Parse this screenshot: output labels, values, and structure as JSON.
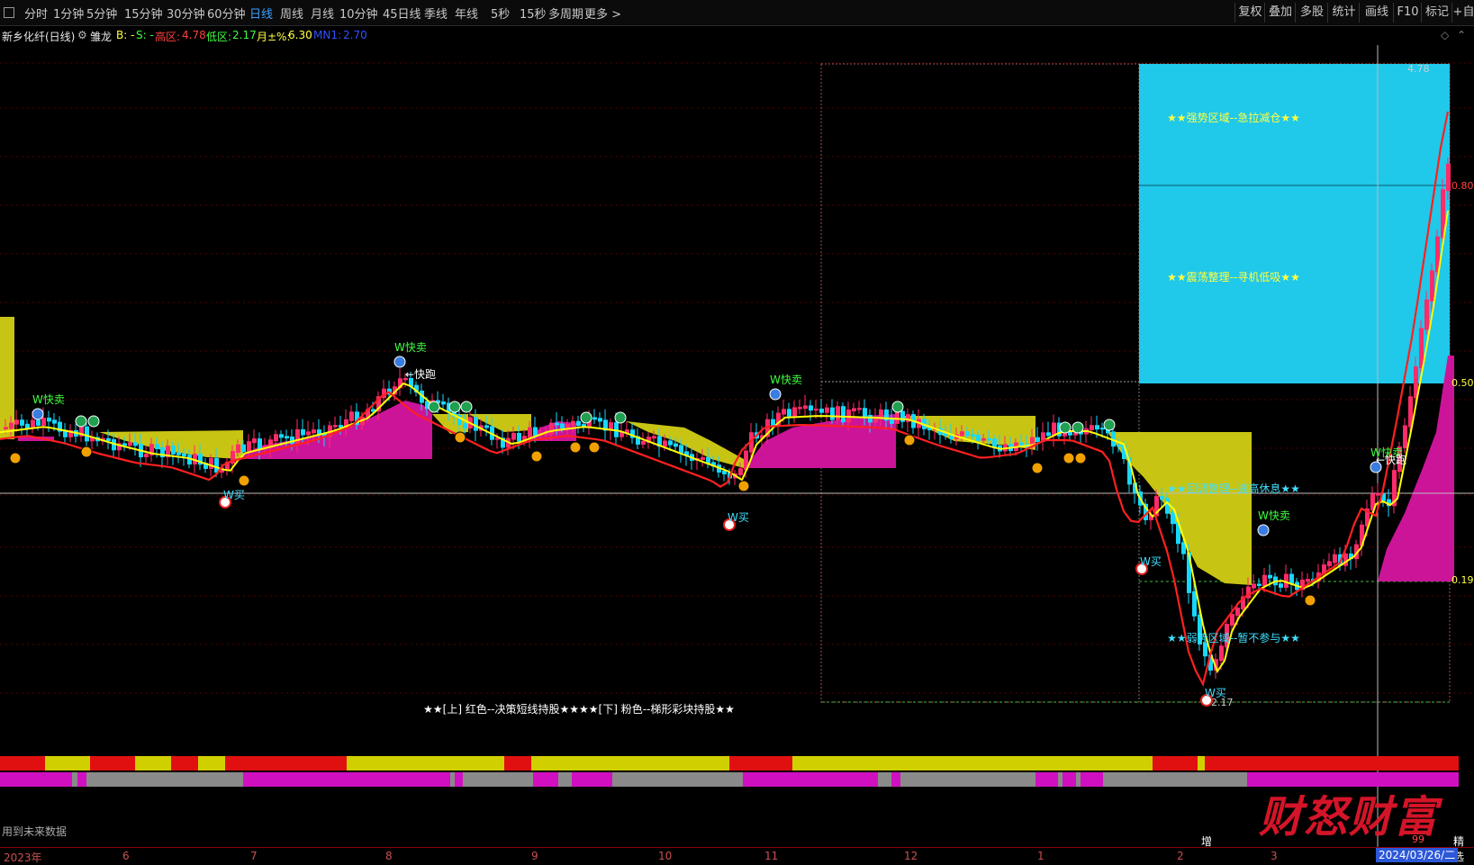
{
  "toolbar": {
    "periods": [
      "分时",
      "1分钟",
      "5分钟",
      "15分钟",
      "30分钟",
      "60分钟",
      "日线",
      "周线",
      "月线",
      "10分钟",
      "45日线",
      "季线",
      "年线",
      "5秒",
      "15秒",
      "多周期",
      "更多 >"
    ],
    "active_period": "日线",
    "right_buttons": [
      "复权",
      "叠加",
      "多股",
      "统计",
      "画线",
      "F10",
      "标记",
      "+自"
    ]
  },
  "info": {
    "stock": "新乡化纤(日线)",
    "indicator": "雏龙",
    "b": "B: -",
    "s": "S: -",
    "high_label": "高区:",
    "high_value": "4.78",
    "low_label": "低区:",
    "low_value": "2.17",
    "month_label": "月±%:",
    "month_value": "6.30",
    "mn_label": "MN1:",
    "mn_value": "2.70"
  },
  "chart_data": {
    "type": "candlestick",
    "price_labels": [
      {
        "text": "4.78",
        "value": 4.78
      },
      {
        "text": "0.80",
        "value": 0.8
      },
      {
        "text": "0.50",
        "value": 0.5
      },
      {
        "text": "0.19",
        "value": 0.19
      },
      {
        "text": "2.17",
        "value": 2.17
      }
    ],
    "zone_labels": [
      "★★强势区域--急拉减仓★★",
      "★★震荡整理--寻机低吸★★",
      "★★回调整理--逢高休息★★",
      "★★弱势区域--暂不参与★★"
    ],
    "signals": [
      {
        "type": "sell",
        "text": "W快卖"
      },
      {
        "type": "sell",
        "text": "W快卖"
      },
      {
        "type": "sell",
        "text": "W快卖"
      },
      {
        "type": "sell",
        "text": "W快卖"
      },
      {
        "type": "sell",
        "text": "W快卖"
      },
      {
        "type": "buy",
        "text": "W买"
      },
      {
        "type": "buy",
        "text": "W买"
      },
      {
        "type": "buy",
        "text": "W买"
      },
      {
        "type": "buy",
        "text": "W买"
      },
      {
        "type": "run",
        "text": "←快跑"
      },
      {
        "type": "run",
        "text": "←快跑"
      }
    ],
    "legend_note": "★★[上] 红色--决策短线持股★★★★[下] 粉色--梯形彩块持股★★",
    "series_colors": {
      "up": "#ff2b6a",
      "down": "#16d8ff",
      "ma": "#ff2020",
      "trend": "#ffff00",
      "zone_pink": "#cc1499",
      "zone_olive": "#c8c414",
      "zone_cyan": "#20c8ea"
    },
    "x_axis_labels": [
      "2023年",
      "6",
      "7",
      "8",
      "9",
      "10",
      "11",
      "12",
      "1",
      "2",
      "3"
    ]
  },
  "bottom": {
    "future_note": "用到未来数据",
    "zeng": "增",
    "date": "2024/03/26/二",
    "watermark": "财怒财富",
    "wm_sub": "99",
    "wm_sub2": "精选"
  }
}
